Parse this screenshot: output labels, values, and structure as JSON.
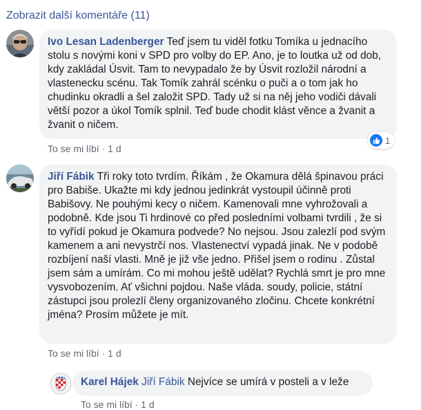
{
  "more_comments": "Zobrazit další komentáře (11)",
  "comments": [
    {
      "author": "Ivo Lesan Ladenberger",
      "text": " Teď jsem tu viděl fotku Tomíka u jednacího stolu s novými koni v SPD pro volby do EP. Ano, je to loutka už od dob, kdy zakládal Úsvit. Tam to nevypadalo že by Úsvit rozložil národní a vlastenecku scénu. Tak Tomík zahrál scénku o puči a o tom jak ho chudinku okradli a šel založit SPD. Tady už si na něj jeho vodiči dávali větší pozor a úkol Tomík splnil. Teď bude chodit klást věnce a žvanit a žvanit o ničem.",
      "like_label": "To se mi líbí",
      "separator": " · ",
      "time": "1 d",
      "reaction_count": "1"
    },
    {
      "author": "Jiří Fábik",
      "text": " Tři roky toto tvrdím. Říkám , že Okamura dělá špinavou práci pro Babiše. Ukažte mi kdy jednou jedinkrát vystoupil účinně proti Babišovy. Ne pouhými kecy o ničem. Kamenovali mne vyhrožovali a podobně. Kde jsou Ti hrdinové co před posledními volbami tvrdili , že si to vyřídí pokud je Okamura podvede? No nejsou. Jsou zalezlí pod svým kamenem a ani nevystrčí nos. Vlastenectví vypadá jinak. Ne v podobě rozbíjení naší vlasti. Mně je již vše jedno. Přišel jsem o rodinu . Zůstal jsem sám a umírám. Co mi mohou ještě udělat? Rychlá smrt je pro mne vysvobozením. Ať všichni pojdou. Naše vláda. soudy, policie, státní zástupci jsou prolezlí členy organizovaného zločinu. Chcete konkrétní jména? Prosím můžete je mít.",
      "like_label": "To se mi líbí",
      "separator": " · ",
      "time": "1 d"
    }
  ],
  "reply": {
    "author": "Karel Hájek",
    "mention": "Jiří Fábik",
    "text": " Nejvíce se umírá v posteli a v leže",
    "like_label": "To se mi líbí",
    "separator": " · ",
    "time": "1 d"
  },
  "colors": {
    "link": "#385898",
    "bubble": "#f2f3f5",
    "meta": "#606770",
    "like_blue": "#1877f2"
  }
}
